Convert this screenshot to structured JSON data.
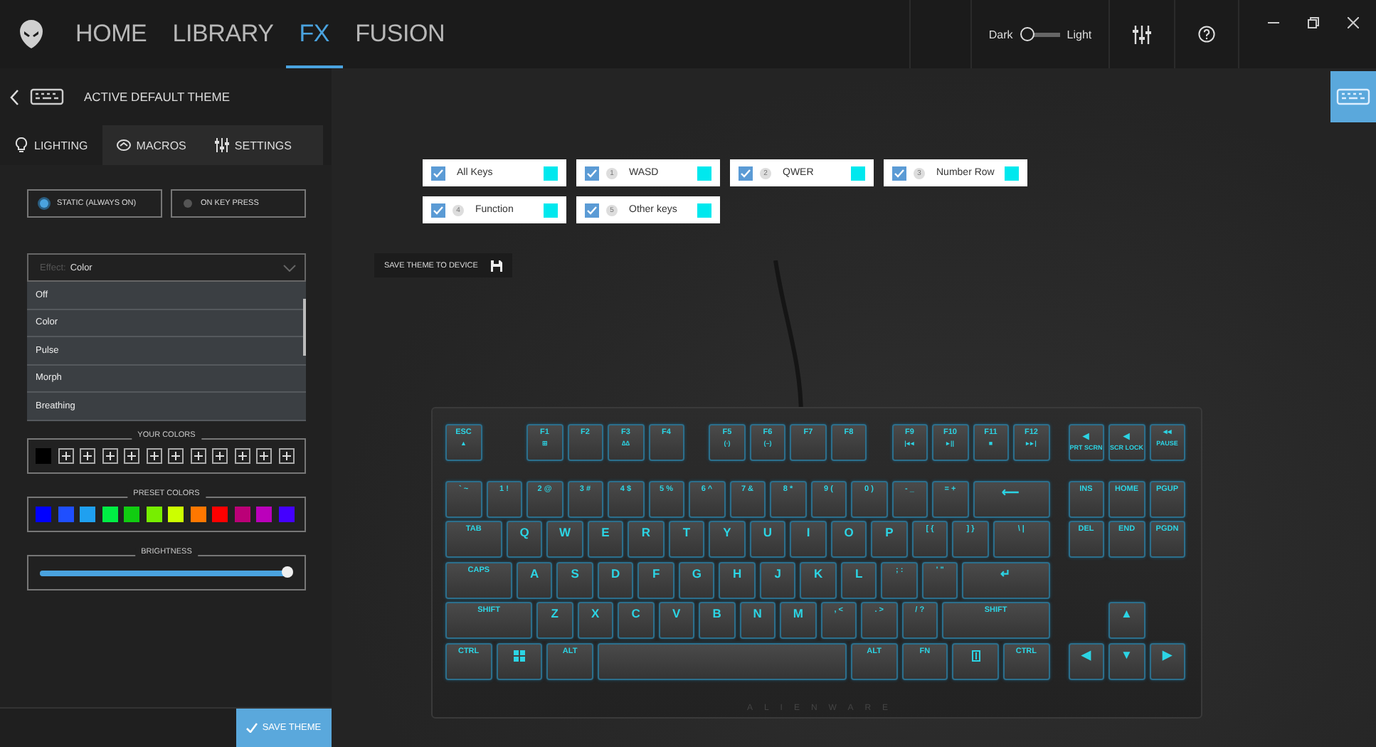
{
  "topbar": {
    "tabs": [
      {
        "label": "HOME",
        "selected": false
      },
      {
        "label": "LIBRARY",
        "selected": false
      },
      {
        "label": "FX",
        "selected": true
      },
      {
        "label": "FUSION",
        "selected": false
      }
    ],
    "theme_toggle": {
      "left_label": "Dark",
      "right_label": "Light",
      "light": false
    }
  },
  "theme_header": {
    "title": "ACTIVE DEFAULT THEME"
  },
  "panel_tabs": [
    {
      "label": "LIGHTING",
      "kind": "bulb",
      "selected": true
    },
    {
      "label": "MACROS",
      "kind": "macro",
      "selected": false
    },
    {
      "label": "SETTINGS",
      "kind": "sliders",
      "selected": false
    }
  ],
  "modes": [
    {
      "label": "STATIC (ALWAYS ON)",
      "selected": true
    },
    {
      "label": "ON KEY PRESS",
      "selected": false
    }
  ],
  "effect": {
    "label": "Effect:",
    "value": "Color",
    "expanded": true,
    "options": [
      "Off",
      "Color",
      "Pulse",
      "Morph",
      "Breathing"
    ]
  },
  "your_colors": {
    "title": "YOUR COLORS",
    "slots": [
      {
        "kind": "color",
        "color": "#000000"
      },
      {
        "kind": "add"
      },
      {
        "kind": "add"
      },
      {
        "kind": "add"
      },
      {
        "kind": "add"
      },
      {
        "kind": "add"
      },
      {
        "kind": "add"
      },
      {
        "kind": "add"
      },
      {
        "kind": "add"
      },
      {
        "kind": "add"
      },
      {
        "kind": "add"
      },
      {
        "kind": "add"
      }
    ]
  },
  "preset_colors": {
    "title": "PRESET COLORS",
    "colors": [
      {
        "color": "#0000ff"
      },
      {
        "color": "#1f4fff"
      },
      {
        "color": "#1fa0f0"
      },
      {
        "color": "#00ee44"
      },
      {
        "color": "#11cc11"
      },
      {
        "color": "#77ee00"
      },
      {
        "color": "#ccff00"
      },
      {
        "color": "#ff7700"
      },
      {
        "color": "#ff0000"
      },
      {
        "color": "#bb0077"
      },
      {
        "color": "#bb00bb"
      },
      {
        "color": "#4400ff"
      }
    ]
  },
  "brightness": {
    "title": "BRIGHTNESS",
    "level": 0.98
  },
  "save_theme": {
    "label": "SAVE THEME"
  },
  "key_groups": [
    {
      "label": "All Keys",
      "checked": true,
      "color": "#00e8ee"
    },
    {
      "number": "1",
      "label": "WASD",
      "checked": true,
      "color": "#00e8ee"
    },
    {
      "number": "2",
      "label": "QWER",
      "checked": true,
      "color": "#00e8ee"
    },
    {
      "number": "3",
      "label": "Number Row",
      "checked": true,
      "color": "#00e8ee"
    },
    {
      "number": "4",
      "label": "Function",
      "checked": true,
      "color": "#00e8ee"
    },
    {
      "number": "5",
      "label": "Other keys",
      "checked": true,
      "color": "#00e8ee"
    }
  ],
  "save_to_device": {
    "label": "SAVE THEME TO DEVICE"
  },
  "keyboard": {
    "brand": "ALIENWARE",
    "rows": [
      {
        "main": [
          {
            "kind": "key",
            "label": "ESC",
            "sub": "▲"
          },
          {
            "kind": "gap"
          },
          {
            "kind": "key",
            "label": "F1",
            "sub": "⊞"
          },
          {
            "kind": "key",
            "label": "F2"
          },
          {
            "kind": "key",
            "label": "F3",
            "sub": "∆∆"
          },
          {
            "kind": "key",
            "label": "F4"
          },
          {
            "kind": "halfgap"
          },
          {
            "kind": "key",
            "label": "F5",
            "sub": "(◦)"
          },
          {
            "kind": "key",
            "label": "F6",
            "sub": "(–)"
          },
          {
            "kind": "key",
            "label": "F7"
          },
          {
            "kind": "key",
            "label": "F8"
          },
          {
            "kind": "halfgap"
          },
          {
            "kind": "key",
            "label": "F9",
            "sub": "|◂◂"
          },
          {
            "kind": "key",
            "label": "F10",
            "sub": "▸||"
          },
          {
            "kind": "key",
            "label": "F11",
            "sub": "■"
          },
          {
            "kind": "key",
            "label": "F12",
            "sub": "▸▸|"
          }
        ],
        "nav": [
          {
            "kind": "key",
            "label": "◂",
            "sub": "PRT SCRN"
          },
          {
            "kind": "key",
            "label": "◂",
            "sub": "SCR LOCK"
          },
          {
            "kind": "key",
            "label": "◂◂",
            "sub": "PAUSE"
          }
        ]
      },
      {
        "main": [
          {
            "kind": "key",
            "label": "` ~"
          },
          {
            "kind": "key",
            "label": "1 !"
          },
          {
            "kind": "key",
            "label": "2 @"
          },
          {
            "kind": "key",
            "label": "3 #"
          },
          {
            "kind": "key",
            "label": "4 $"
          },
          {
            "kind": "key",
            "label": "5 %"
          },
          {
            "kind": "key",
            "label": "6 ^"
          },
          {
            "kind": "key",
            "label": "7 &"
          },
          {
            "kind": "key",
            "label": "8 *"
          },
          {
            "kind": "key",
            "label": "9 ("
          },
          {
            "kind": "key",
            "label": "0 )"
          },
          {
            "kind": "key",
            "label": "- _"
          },
          {
            "kind": "key",
            "label": "= +"
          },
          {
            "kind": "backspace",
            "label": "⟵"
          }
        ],
        "nav": [
          {
            "kind": "key",
            "label": "INS"
          },
          {
            "kind": "key",
            "label": "HOME"
          },
          {
            "kind": "key",
            "label": "PGUP"
          }
        ]
      },
      {
        "main": [
          {
            "kind": "tab",
            "label": "TAB"
          },
          {
            "kind": "key",
            "label": "Q"
          },
          {
            "kind": "key",
            "label": "W"
          },
          {
            "kind": "key",
            "label": "E"
          },
          {
            "kind": "key",
            "label": "R"
          },
          {
            "kind": "key",
            "label": "T"
          },
          {
            "kind": "key",
            "label": "Y"
          },
          {
            "kind": "key",
            "label": "U"
          },
          {
            "kind": "key",
            "label": "I"
          },
          {
            "kind": "key",
            "label": "O"
          },
          {
            "kind": "key",
            "label": "P"
          },
          {
            "kind": "key",
            "label": "[ {"
          },
          {
            "kind": "key",
            "label": "] }"
          },
          {
            "kind": "backslash",
            "label": "\\ |"
          }
        ],
        "nav": [
          {
            "kind": "key",
            "label": "DEL"
          },
          {
            "kind": "key",
            "label": "END"
          },
          {
            "kind": "key",
            "label": "PGDN"
          }
        ]
      },
      {
        "main": [
          {
            "kind": "caps",
            "label": "CAPS"
          },
          {
            "kind": "key",
            "label": "A"
          },
          {
            "kind": "key",
            "label": "S"
          },
          {
            "kind": "key",
            "label": "D"
          },
          {
            "kind": "key",
            "label": "F"
          },
          {
            "kind": "key",
            "label": "G"
          },
          {
            "kind": "key",
            "label": "H"
          },
          {
            "kind": "key",
            "label": "J"
          },
          {
            "kind": "key",
            "label": "K"
          },
          {
            "kind": "key",
            "label": "L"
          },
          {
            "kind": "key",
            "label": "; :"
          },
          {
            "kind": "key",
            "label": "' \""
          },
          {
            "kind": "enter",
            "label": "↵"
          }
        ]
      },
      {
        "main": [
          {
            "kind": "lshift",
            "label": "SHIFT"
          },
          {
            "kind": "key",
            "label": "Z"
          },
          {
            "kind": "key",
            "label": "X"
          },
          {
            "kind": "key",
            "label": "C"
          },
          {
            "kind": "key",
            "label": "V"
          },
          {
            "kind": "key",
            "label": "B"
          },
          {
            "kind": "key",
            "label": "N"
          },
          {
            "kind": "key",
            "label": "M"
          },
          {
            "kind": "key",
            "label": ", <"
          },
          {
            "kind": "key",
            "label": ". >"
          },
          {
            "kind": "key",
            "label": "/ ?"
          },
          {
            "kind": "rshift",
            "label": "SHIFT"
          }
        ],
        "nav": [
          {
            "kind": "gap"
          },
          {
            "kind": "key",
            "label": "▲"
          },
          {
            "kind": "gap"
          }
        ]
      },
      {
        "main": [
          {
            "kind": "mod",
            "label": "CTRL"
          },
          {
            "kind": "win"
          },
          {
            "kind": "mod",
            "label": "ALT"
          },
          {
            "kind": "space"
          },
          {
            "kind": "mod",
            "label": "ALT"
          },
          {
            "kind": "mod",
            "label": "FN"
          },
          {
            "kind": "menu"
          },
          {
            "kind": "mod",
            "label": "CTRL"
          }
        ],
        "nav": [
          {
            "kind": "key",
            "label": "◀"
          },
          {
            "kind": "key",
            "label": "▼"
          },
          {
            "kind": "key",
            "label": "▶"
          }
        ]
      }
    ]
  }
}
